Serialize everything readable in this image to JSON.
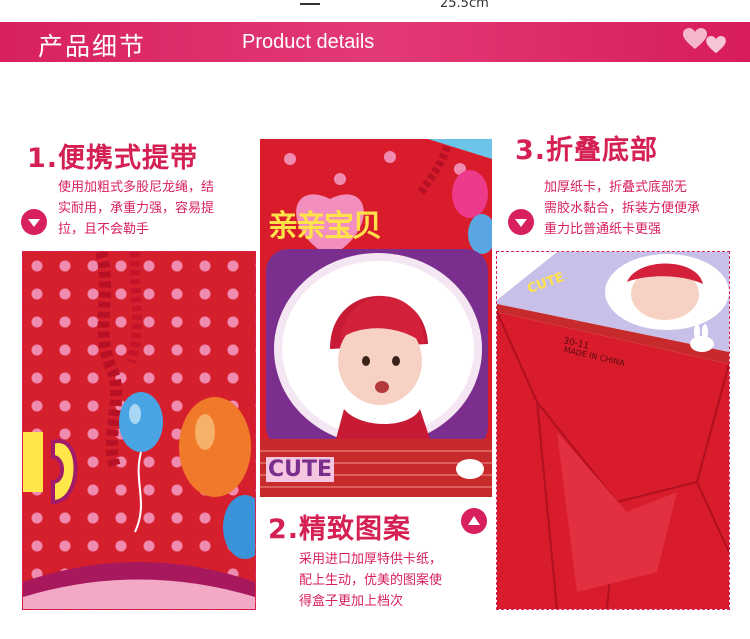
{
  "top_fragment": "25.5cm",
  "banner": {
    "zh": "产品细节",
    "en": "Product details",
    "heart_color": "#f4b6c8"
  },
  "sections": [
    {
      "title": "1.便携式提带",
      "desc_lines": [
        "使用加粗式多股尼龙绳，结",
        "实耐用，承重力强，容易提",
        "拉，且不会勒手"
      ],
      "arrow": "down-arrow"
    },
    {
      "title": "2.精致图案",
      "desc_lines": [
        "采用进口加厚特供卡纸，",
        "配上生动，优美的图案使",
        "得盒子更加上档次"
      ],
      "arrow": "up-arrow"
    },
    {
      "title": "3.折叠底部",
      "desc_lines": [
        "加厚纸卡，折叠式底部无",
        "需胶水黏合，拆装方便便承",
        "重力比普通纸卡更强"
      ],
      "arrow": "down-arrow"
    }
  ],
  "photo_text": {
    "baby_logo": "亲亲宝贝",
    "cute_text": "CUTE",
    "bottom_code": "30-11",
    "made_in": "MADE IN CHINA"
  },
  "colors": {
    "accent": "#d8205f",
    "title": "#d42052",
    "bag_red": "#d61f2d"
  }
}
